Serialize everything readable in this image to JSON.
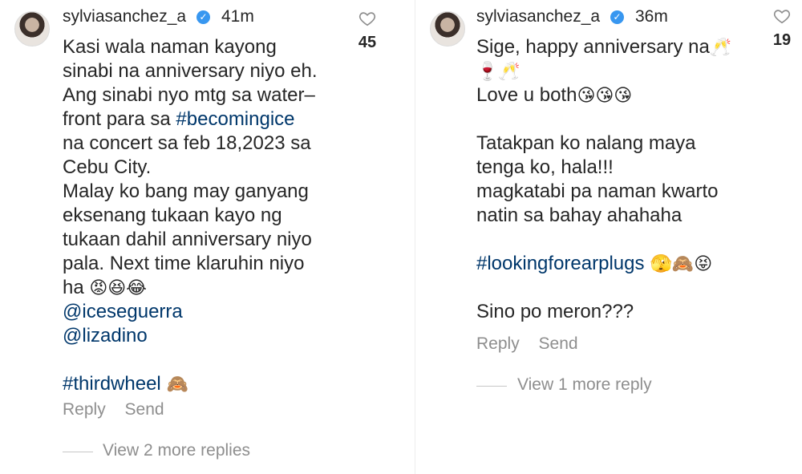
{
  "left_comment": {
    "username": "sylviasanchez_a",
    "time": "41m",
    "likes": "45",
    "lines": [
      [
        {
          "t": "Kasi wala naman kayong"
        }
      ],
      [
        {
          "t": "sinabi na anniversary niyo eh."
        }
      ],
      [
        {
          "t": "Ang sinabi nyo mtg sa water–"
        }
      ],
      [
        {
          "t": "front para sa  "
        },
        {
          "t": "#becomingice",
          "c": "blue"
        }
      ],
      [
        {
          "t": "na concert sa feb 18,2023 sa"
        }
      ],
      [
        {
          "t": "Cebu City."
        }
      ],
      [
        {
          "t": "Malay ko bang may ganyang"
        }
      ],
      [
        {
          "t": "eksenang tukaan kayo ng"
        }
      ],
      [
        {
          "t": "tukaan dahil anniversary niyo"
        }
      ],
      [
        {
          "t": "pala. Next time klaruhin niyo"
        }
      ],
      [
        {
          "t": "ha "
        },
        {
          "t": "😡😆😂",
          "c": "emoji"
        }
      ],
      [
        {
          "t": "@iceseguerra",
          "c": "blue"
        }
      ],
      [
        {
          "t": "@lizadino",
          "c": "blue"
        }
      ],
      [],
      [
        {
          "t": "#thirdwheel",
          "c": "blue"
        },
        {
          "t": " 🙈",
          "c": "emoji"
        }
      ]
    ],
    "reply_label": "Reply",
    "send_label": "Send",
    "view_more": "View 2 more replies"
  },
  "right_comment": {
    "username": "sylviasanchez_a",
    "time": "36m",
    "likes": "19",
    "lines": [
      [
        {
          "t": "Sige, happy anniversary na"
        },
        {
          "t": "🥂",
          "c": "emoji"
        }
      ],
      [
        {
          "t": "🍷🥂",
          "c": "emoji"
        }
      ],
      [
        {
          "t": "Love u both"
        },
        {
          "t": "😘😘😘",
          "c": "emoji"
        }
      ],
      [],
      [
        {
          "t": "Tatakpan ko nalang maya"
        }
      ],
      [
        {
          "t": "tenga ko, hala!!!"
        }
      ],
      [
        {
          "t": "magkatabi pa naman kwarto"
        }
      ],
      [
        {
          "t": "natin sa bahay ahahaha"
        }
      ],
      [],
      [
        {
          "t": "#lookingforearplugs",
          "c": "blue"
        },
        {
          "t": " 🫣🙈😝",
          "c": "emoji"
        }
      ],
      [],
      [
        {
          "t": "Sino po meron???"
        }
      ]
    ],
    "reply_label": "Reply",
    "send_label": "Send",
    "view_more": "View 1 more reply"
  },
  "icons": {
    "heart": "heart-outline-icon",
    "verified": "verified-badge-icon",
    "avatar": "profile-avatar"
  },
  "colors": {
    "text": "#262626",
    "link": "#00376b",
    "muted": "#8e8e8e",
    "verified": "#3897f0"
  }
}
